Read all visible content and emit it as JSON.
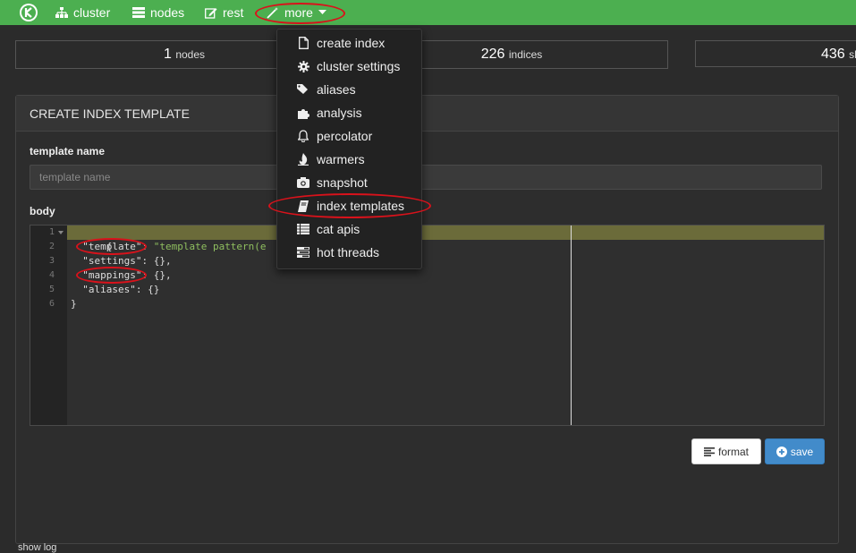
{
  "nav": {
    "cluster": "cluster",
    "nodes": "nodes",
    "rest": "rest",
    "more": "more"
  },
  "stats": {
    "nodes_value": "1",
    "nodes_label": "nodes",
    "indices_value": "226",
    "indices_label": "indices",
    "shards_value": "436",
    "shards_label": "sh"
  },
  "panel": {
    "title": "CREATE INDEX TEMPLATE",
    "template_name_label": "template name",
    "template_name_placeholder": "template name",
    "template_name_value": "",
    "body_label": "body"
  },
  "editor": {
    "line_numbers": [
      "1",
      "2",
      "3",
      "4",
      "5",
      "6"
    ],
    "lines": [
      {
        "key": "{",
        "val": ""
      },
      {
        "key": "  \"template\": ",
        "val": "\"template pattern(e"
      },
      {
        "key": "  \"settings\": {},",
        "val": ""
      },
      {
        "key": "  \"mappings\": {},",
        "val": ""
      },
      {
        "key": "  \"aliases\": {}",
        "val": ""
      },
      {
        "key": "}",
        "val": ""
      }
    ]
  },
  "buttons": {
    "format": "format",
    "save": "save"
  },
  "menu": {
    "items": [
      {
        "label": "create index",
        "icon": "file-icon"
      },
      {
        "label": "cluster settings",
        "icon": "gear-icon"
      },
      {
        "label": "aliases",
        "icon": "tags-icon"
      },
      {
        "label": "analysis",
        "icon": "puzzle-icon"
      },
      {
        "label": "percolator",
        "icon": "bell-icon"
      },
      {
        "label": "warmers",
        "icon": "fire-icon"
      },
      {
        "label": "snapshot",
        "icon": "camera-icon"
      },
      {
        "label": "index templates",
        "icon": "book-icon"
      },
      {
        "label": "cat apis",
        "icon": "list-icon"
      },
      {
        "label": "hot threads",
        "icon": "tasks-icon"
      }
    ]
  },
  "footer": {
    "show_log": "show log"
  },
  "colors": {
    "topbar": "#4caf50",
    "annotation": "#d9121b",
    "save_button": "#428bca",
    "active_line": "#6b6b3a"
  }
}
